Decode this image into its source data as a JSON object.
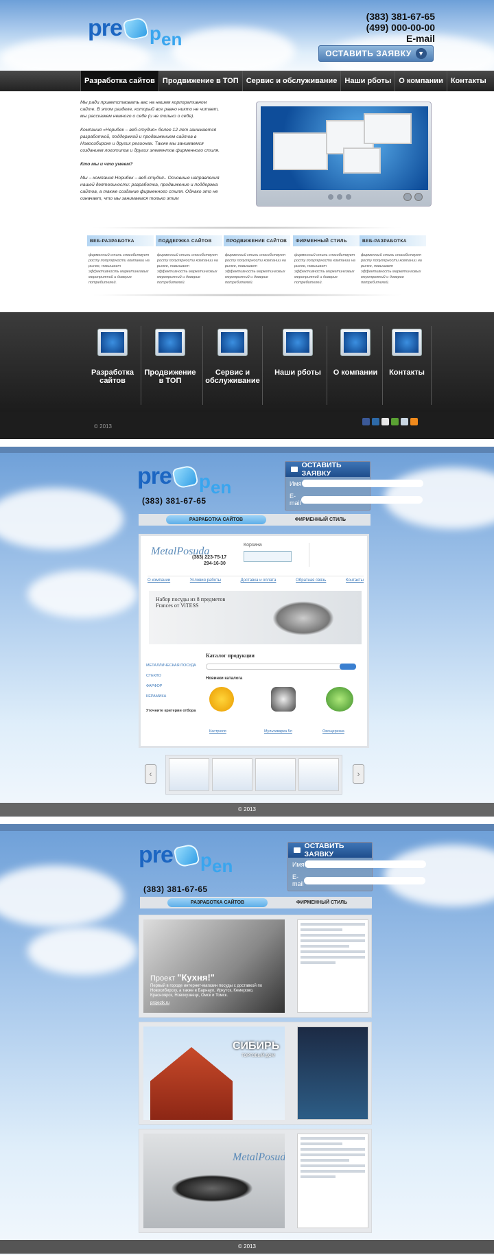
{
  "brand": {
    "p1": "pre",
    "p2": "p",
    "p3": "en"
  },
  "header": {
    "phone1": "(383) 381-67-65",
    "phone2": "(499) 000-00-00",
    "email": "E-mail",
    "order_button": "ОСТАВИТЬ ЗАЯВКУ"
  },
  "nav": [
    "Разработка сайтов",
    "Продвижение в ТОП",
    "Сервис и обслуживание",
    "Наши рботы",
    "О компании",
    "Контакты"
  ],
  "intro": {
    "p1": "Мы ради приветствовать вас на нашем корпоративном сайте. В этом разделе, который все равно никто не читает, мы расскажем немного о себе (и не только о себе).",
    "p2": "Компания «Норибек – веб-студия» более 12 лет занимается разработкой, поддержкой и продвижением сайтов в Новосибирске и других регионах. Также мы занимаемся созданием логотипов и других элементов фирменного стиля.",
    "heading": "Кто мы и что умеем?",
    "p3": "Мы – компания Норибек – веб-студия.. Основные направления нашей деятельности: разработка, продвижение и поддержка сайтов, а также создание фирменного стиля. Однако это не означает, что мы занимаемся только этим"
  },
  "services": [
    {
      "title": "ВЕБ-РАЗРАБОТКА",
      "text": "фирменный стиль способствует росту популярности компании на рынке, повышает эффективность маркетинговых мероприятий и доверие потребителей."
    },
    {
      "title": "ПОДДЕРЖКА САЙТОВ",
      "text": "фирменный стиль способствует росту популярности компании на рынке, повышает эффективность маркетинговых мероприятий и доверие потребителей."
    },
    {
      "title": "ПРОДВИЖЕНИЕ САЙТОВ",
      "text": "фирменный стиль способствует росту популярности компании на рынке, повышает эффективность маркетинговых мероприятий и доверие потребителей."
    },
    {
      "title": "ФИРМЕННЫЙ СТИЛЬ",
      "text": "фирменный стиль способствует росту популярности компании на рынке, повышает эффективность маркетинговых мероприятий и доверие потребителей."
    },
    {
      "title": "ВЕБ-РАЗРАБОТКА",
      "text": "фирменный стиль способствует росту популярности компании на рынке, повышает эффективность маркетинговых мероприятий и доверие потребителей."
    }
  ],
  "dark_menu": [
    "Разработка сайтов",
    "Продвижение в ТОП",
    "Сервис и обслуживание",
    "Наши рботы",
    "О компании",
    "Контакты"
  ],
  "footer": {
    "copyright": "© 2013"
  },
  "page2": {
    "order_button": "ОСТАВИТЬ ЗАЯВКУ",
    "name_label": "Имя",
    "email_label": "E-mail",
    "phone": "(383)  381-67-65",
    "tab_active": "РАЗРАБОТКА САЙТОВ",
    "tab_other": "ФИРМЕННЫЙ СТИЛЬ",
    "shop": {
      "phone1": "(383) 223-75-17",
      "phone2": "294-16-30",
      "cart": "Корзина",
      "menu": [
        "О компании",
        "Условия работы",
        "Доставка и оплата",
        "Обратная связь",
        "Контакты"
      ],
      "banner": "Набор посуды из 8 предметов Frances от ViTESS",
      "catalog": "Каталог продукции",
      "news": "Новинки каталога",
      "cats": [
        "МЕТАЛЛИЧЕСКАЯ ПОСУДА",
        "СТЕКЛО",
        "ФАРФОР",
        "КЕРАМИКА"
      ],
      "filter": "Уточните критерии отбора",
      "products": [
        "Кастрюля",
        "Мультиварка 5л",
        "Овощерезка"
      ]
    },
    "copyright": "© 2013"
  },
  "page3": {
    "order_button": "ОСТАВИТЬ ЗАЯВКУ",
    "name_label": "Имя",
    "email_label": "E-mail",
    "phone": "(383)  381-67-65",
    "tab_active": "РАЗРАБОТКА САЙТОВ",
    "tab_other": "ФИРМЕННЫЙ СТИЛЬ",
    "kitchen": {
      "title_prefix": "Проект ",
      "title_name": "\"Кухня!\"",
      "desc": "Первый в городе интернет-магазин посуды с доставкой по Новосибирску, а также в Барнаул, Иркутск, Кемерово, Красноярск, Новокузнецк, Омск и Томск.",
      "link": "projectk.ru"
    },
    "sibir": "СИБИРЬ",
    "sibir_sub": "ТОРГОВЫЙ ДОМ",
    "metal": "MetalPosuda",
    "copyright": "© 2013"
  },
  "colors": {
    "accent": "#1c66c2",
    "nav": "#2b2b2b",
    "tab": "#6db8ec"
  }
}
